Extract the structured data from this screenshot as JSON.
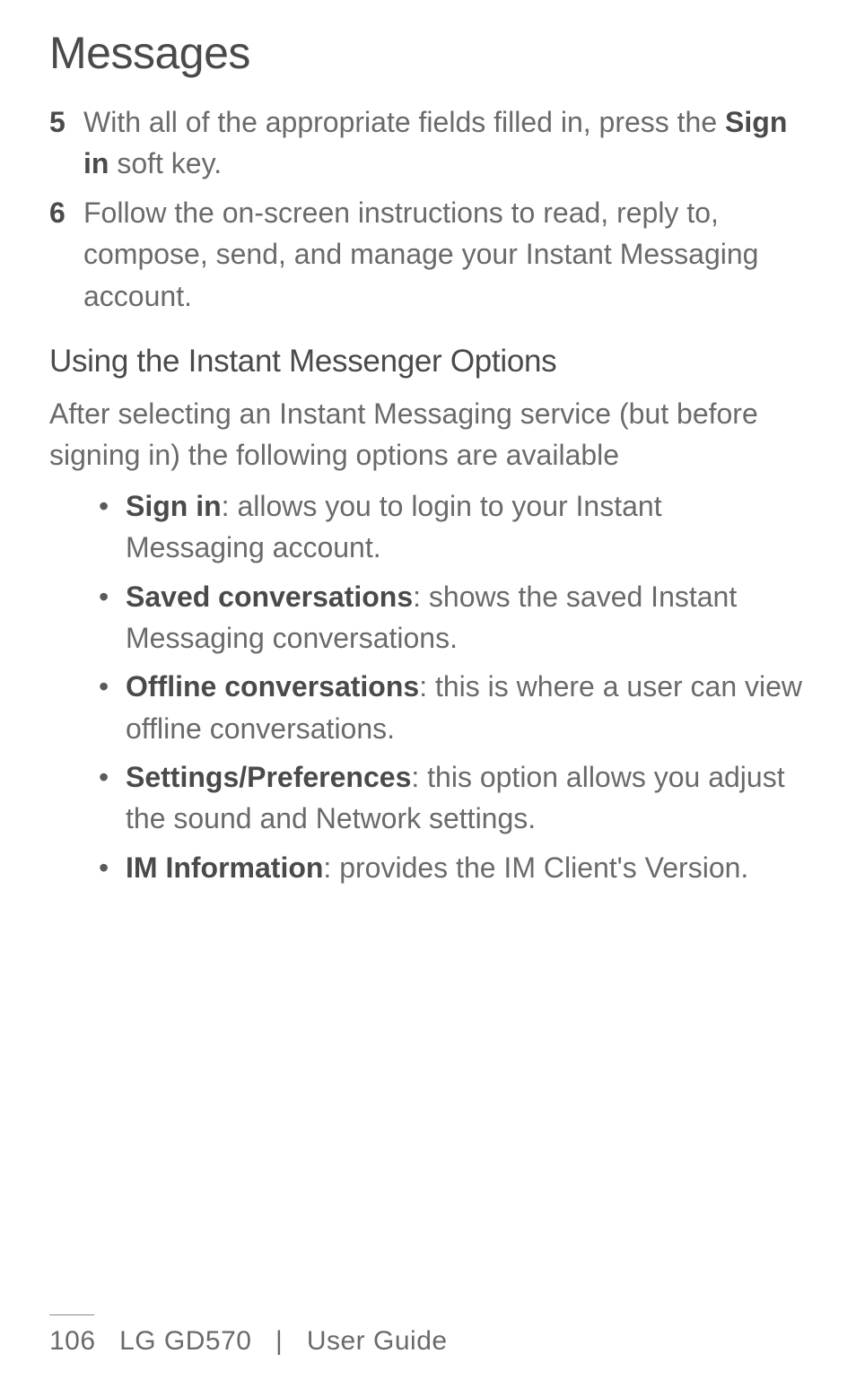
{
  "title": "Messages",
  "steps": [
    {
      "num": "5",
      "parts": [
        {
          "text": "With all of the appropriate fields filled in, press the ",
          "bold": false
        },
        {
          "text": "Sign in",
          "bold": true
        },
        {
          "text": " soft key.",
          "bold": false
        }
      ]
    },
    {
      "num": "6",
      "parts": [
        {
          "text": "Follow the on-screen instructions to read, reply to, compose, send, and manage your Instant Messaging account.",
          "bold": false
        }
      ]
    }
  ],
  "subheading": "Using the Instant Messenger Options",
  "intro": "After selecting an Instant Messaging service (but before signing in) the following options are available",
  "options": [
    {
      "term": "Sign in",
      "desc": ": allows you to login to your Instant Messaging account."
    },
    {
      "term": "Saved conversations",
      "desc": ": shows the saved Instant Messaging conversations."
    },
    {
      "term": "Offline conversations",
      "desc": ": this is where a user can view offline conversations."
    },
    {
      "term": "Settings/Preferences",
      "desc": ": this option allows you adjust the sound and Network settings."
    },
    {
      "term": "IM Information",
      "desc": ": provides the IM Client's Version."
    }
  ],
  "footer": {
    "page_number": "106",
    "product": "LG GD570",
    "separator": "|",
    "doc_type": "User Guide"
  }
}
